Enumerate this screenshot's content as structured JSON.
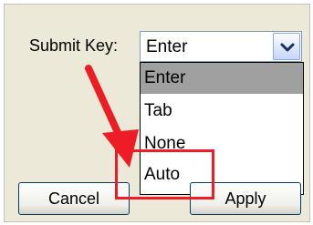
{
  "dialog": {
    "field_label": "Submit Key:",
    "combo_value": "Enter",
    "dropdown_icon": "chevron-down-icon",
    "options": [
      {
        "label": "Enter",
        "selected": true
      },
      {
        "label": "Tab",
        "selected": false
      },
      {
        "label": "None",
        "selected": false
      },
      {
        "label": "Auto",
        "selected": false
      }
    ],
    "cancel_label": "Cancel",
    "apply_label": "Apply"
  },
  "annotation": {
    "color": "#ee1c24",
    "target_option": "Auto"
  }
}
